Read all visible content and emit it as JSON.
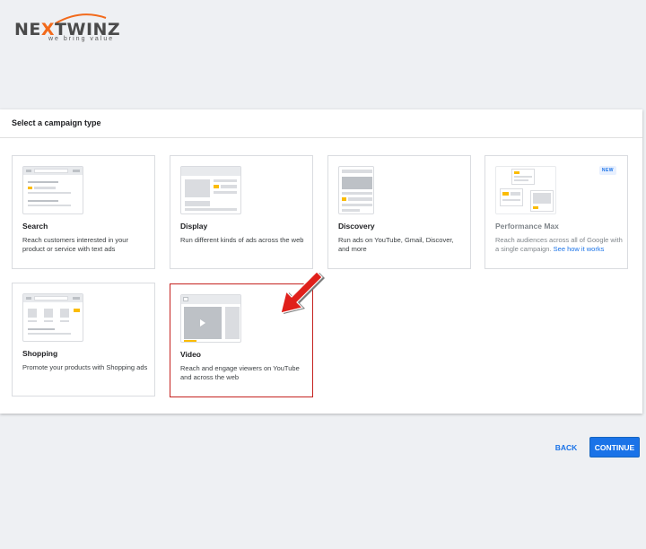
{
  "brand": {
    "logo_prefix": "NE",
    "logo_x": "X",
    "logo_suffix": "TWINZ",
    "tagline": "we bring value"
  },
  "panel": {
    "title": "Select a campaign type"
  },
  "campaign_types": [
    {
      "name": "Search",
      "description": "Reach customers interested in your product or service with text ads"
    },
    {
      "name": "Display",
      "description": "Run different kinds of ads across the web"
    },
    {
      "name": "Discovery",
      "description": "Run ads on YouTube, Gmail, Discover, and more"
    },
    {
      "name": "Performance Max",
      "description": "Reach audiences across all of Google with a single campaign.",
      "link": "See how it works",
      "badge": "NEW"
    },
    {
      "name": "Shopping",
      "description": "Promote your products with Shopping ads"
    },
    {
      "name": "Video",
      "description": "Reach and engage viewers on YouTube and across the web",
      "selected": true
    }
  ],
  "actions": {
    "back_label": "BACK",
    "continue_label": "CONTINUE"
  },
  "colors": {
    "primary": "#1a73e8",
    "selected_border": "#c5221f",
    "accent_yellow": "#fbbc04",
    "logo_orange": "#f26a1b",
    "annotation_arrow": "#e0201b"
  }
}
